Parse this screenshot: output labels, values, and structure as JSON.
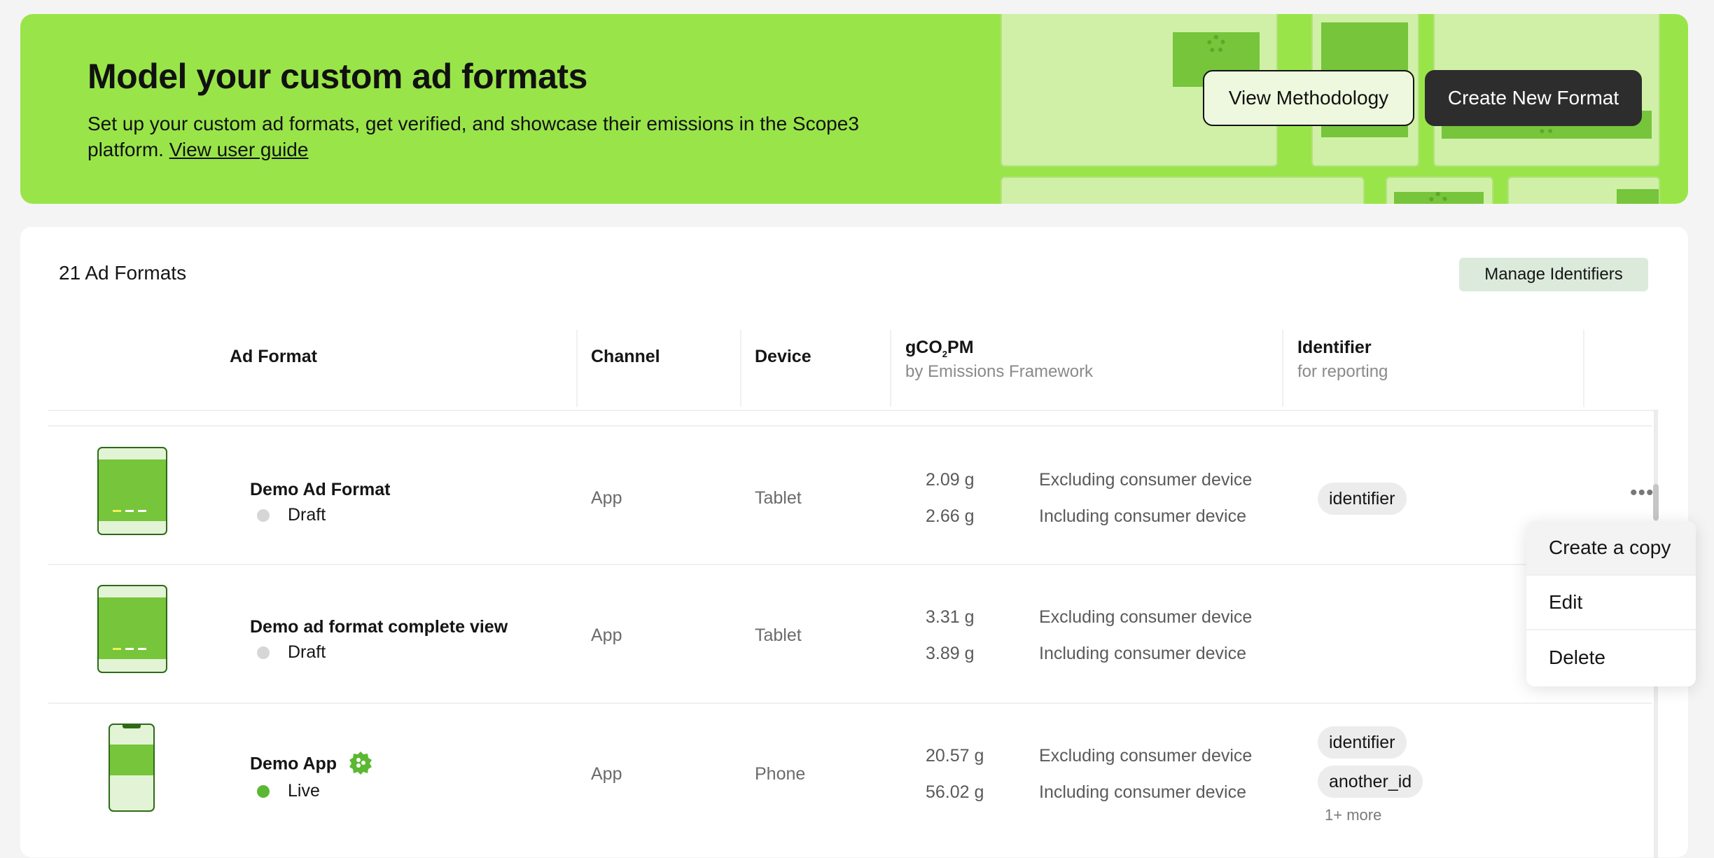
{
  "hero": {
    "title": "Model your custom ad formats",
    "description": "Set up your custom ad formats, get verified, and showcase their emissions in the Scope3 platform.",
    "guide_link": "View user guide",
    "view_methodology": "View Methodology",
    "create_new_format": "Create New Format",
    "accent_color": "#99e549"
  },
  "table": {
    "count_label": "21 Ad Formats",
    "manage_identifiers": "Manage Identifiers",
    "headers": {
      "ad_format": "Ad Format",
      "channel": "Channel",
      "device": "Device",
      "gco2pm_prefix": "gCO",
      "gco2pm_sub": "2",
      "gco2pm_suffix": "PM",
      "gco2pm_subtitle": "by Emissions Framework",
      "identifier": "Identifier",
      "identifier_subtitle": "for reporting"
    },
    "rows": [
      {
        "name": "Demo Ad Format",
        "status": "Draft",
        "channel": "App",
        "device": "Tablet",
        "emissions": [
          {
            "value": "2.09 g",
            "label": "Excluding consumer device"
          },
          {
            "value": "2.66 g",
            "label": "Including consumer device"
          }
        ],
        "identifiers": [
          "identifier"
        ]
      },
      {
        "name": "Demo ad format complete view",
        "status": "Draft",
        "channel": "App",
        "device": "Tablet",
        "emissions": [
          {
            "value": "3.31 g",
            "label": "Excluding consumer device"
          },
          {
            "value": "3.89 g",
            "label": "Including consumer device"
          }
        ],
        "identifiers": []
      },
      {
        "name": "Demo App",
        "status": "Live",
        "channel": "App",
        "device": "Phone",
        "verified": true,
        "emissions": [
          {
            "value": "20.57 g",
            "label": "Excluding consumer device"
          },
          {
            "value": "56.02 g",
            "label": "Including consumer device"
          }
        ],
        "identifiers": [
          "identifier",
          "another_id"
        ],
        "more": "1+ more"
      }
    ]
  },
  "menu": {
    "items": [
      "Create a copy",
      "Edit",
      "Delete"
    ]
  },
  "icons": {
    "kebab": "more-horizontal-icon",
    "verified": "verified-badge-icon"
  }
}
